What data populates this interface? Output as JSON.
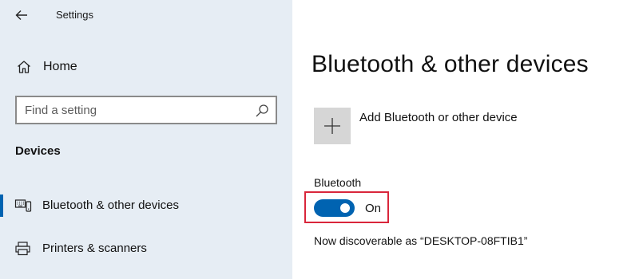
{
  "window": {
    "title": "Settings"
  },
  "sidebar": {
    "home_label": "Home",
    "search": {
      "placeholder": "Find a setting",
      "value": ""
    },
    "section_header": "Devices",
    "items": [
      {
        "label": "Bluetooth & other devices",
        "icon": "bluetooth-devices-icon",
        "active": true
      },
      {
        "label": "Printers & scanners",
        "icon": "printer-icon",
        "active": false
      }
    ]
  },
  "main": {
    "title": "Bluetooth & other devices",
    "add_device_label": "Add Bluetooth or other device",
    "bluetooth_label": "Bluetooth",
    "toggle": {
      "state": "On",
      "on": true
    },
    "discoverable_text": "Now discoverable as “DESKTOP-08FTIB1”"
  },
  "colors": {
    "sidebar_bg": "#e6edf4",
    "accent": "#0063b1",
    "highlight_border": "#d9263b",
    "tile_bg": "#d6d6d6"
  }
}
